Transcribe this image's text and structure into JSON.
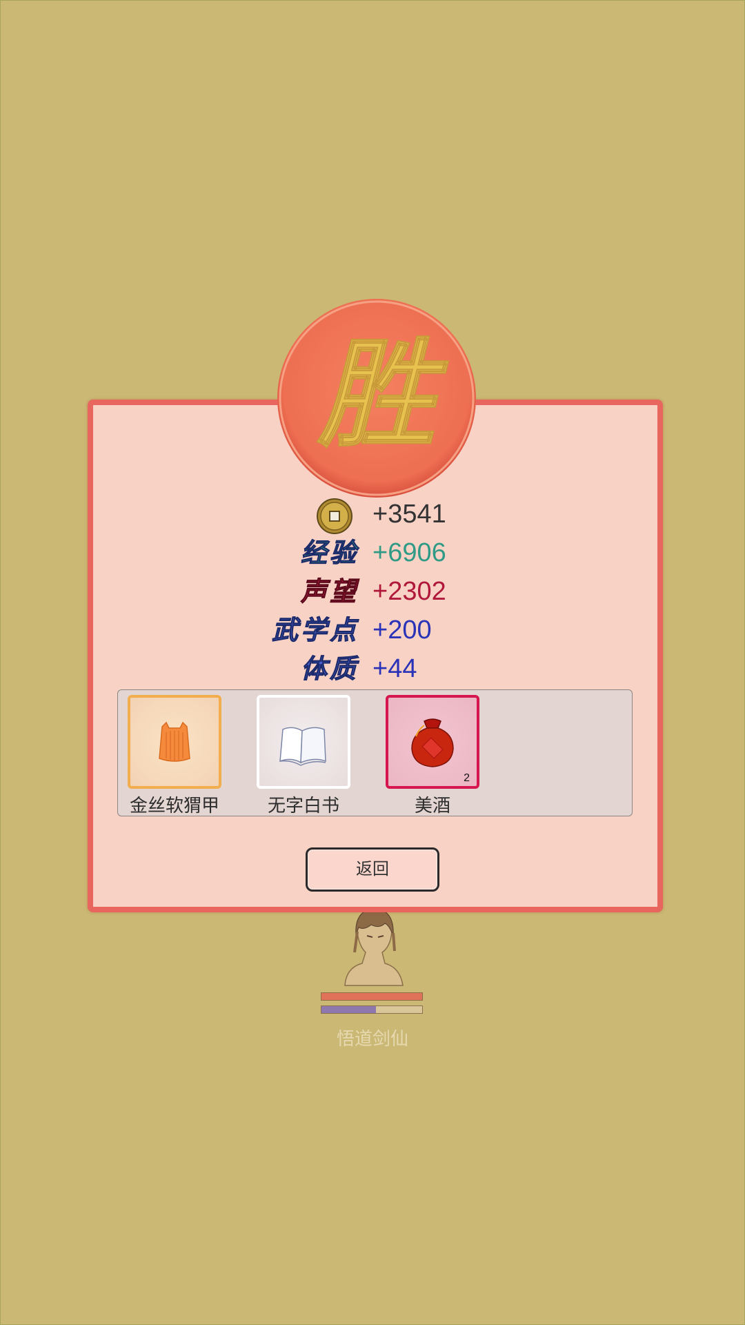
{
  "result_badge": {
    "text": "胜"
  },
  "rewards": [
    {
      "name": "coin",
      "label": "",
      "value": "+3541",
      "color": "#333333"
    },
    {
      "name": "experience",
      "label": "经验",
      "value": "+6906",
      "color": "#2f9a86"
    },
    {
      "name": "reputation",
      "label": "声望",
      "value": "+2302",
      "color": "#b0183a"
    },
    {
      "name": "martial-points",
      "label": "武学点",
      "value": "+200",
      "color": "#2a33b8"
    },
    {
      "name": "constitution",
      "label": "体质",
      "value": "+44",
      "color": "#2a33b8"
    }
  ],
  "items": [
    {
      "name": "金丝软猬甲",
      "icon": "armor-vest-icon",
      "border": "#f1ad4e",
      "count": ""
    },
    {
      "name": "无字白书",
      "icon": "blank-book-icon",
      "border": "#ffffff",
      "count": ""
    },
    {
      "name": "美酒",
      "icon": "wine-jar-icon",
      "border": "#d6174f",
      "count": "2"
    }
  ],
  "back_button": {
    "label": "返回"
  },
  "hero": {
    "name": "悟道剑仙",
    "hp_fraction": 1.0,
    "mp_fraction": 0.54
  },
  "colors": {
    "background": "#cbb874",
    "dialog_fill": "#f9d2c6",
    "dialog_border": "#e9665f",
    "badge": "#ef7356",
    "badge_text": "#e7c24f"
  }
}
